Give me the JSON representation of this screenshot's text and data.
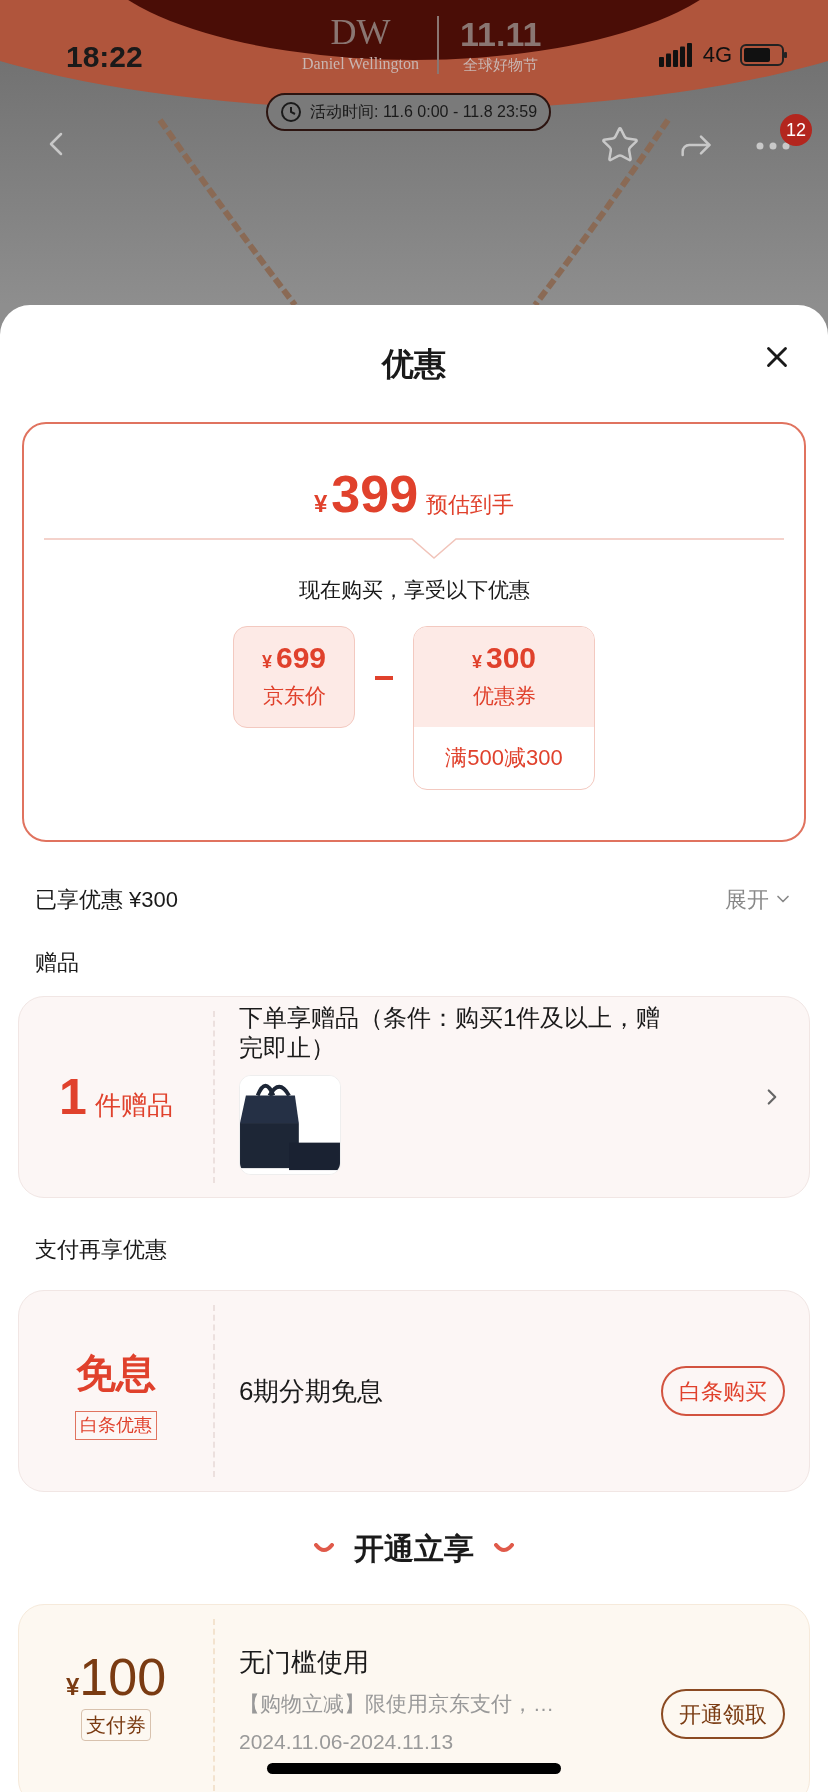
{
  "status_bar": {
    "time": "18:22",
    "network": "4G"
  },
  "banner": {
    "logo": "DW",
    "brand": "Daniel Wellington",
    "event_logo": "11.11",
    "event": "全球好物节",
    "activity_time": "活动时间: 11.6 0:00 - 11.8 23:59"
  },
  "nav": {
    "badge": "12"
  },
  "sheet": {
    "title": "优惠"
  },
  "estimate": {
    "currency": "¥",
    "price": "399",
    "label": "预估到手",
    "subtitle": "现在购买，享受以下优惠",
    "items": [
      {
        "kind": "price",
        "currency": "¥",
        "amount": "699",
        "label": "京东价"
      },
      {
        "kind": "coupon",
        "currency": "¥",
        "amount": "300",
        "label": "优惠券",
        "condition": "满500减300"
      }
    ]
  },
  "saved": {
    "label": "已享优惠 ¥300",
    "toggle": "展开"
  },
  "gifts": {
    "heading": "赠品",
    "count": "1",
    "unit": "件赠品",
    "text": "下单享赠品（条件：购买1件及以上，赠完即止）"
  },
  "payment": {
    "heading": "支付再享优惠",
    "title": "免息",
    "tag": "白条优惠",
    "text": "6期分期免息",
    "button": "白条购买"
  },
  "open": {
    "heading": "开通立享",
    "coupon": {
      "currency": "¥",
      "amount": "100",
      "tag": "支付券",
      "title": "无门槛使用",
      "description": "【购物立减】限使用京东支付，…",
      "dates": "2024.11.06-2024.11.13",
      "button": "开通领取"
    }
  }
}
